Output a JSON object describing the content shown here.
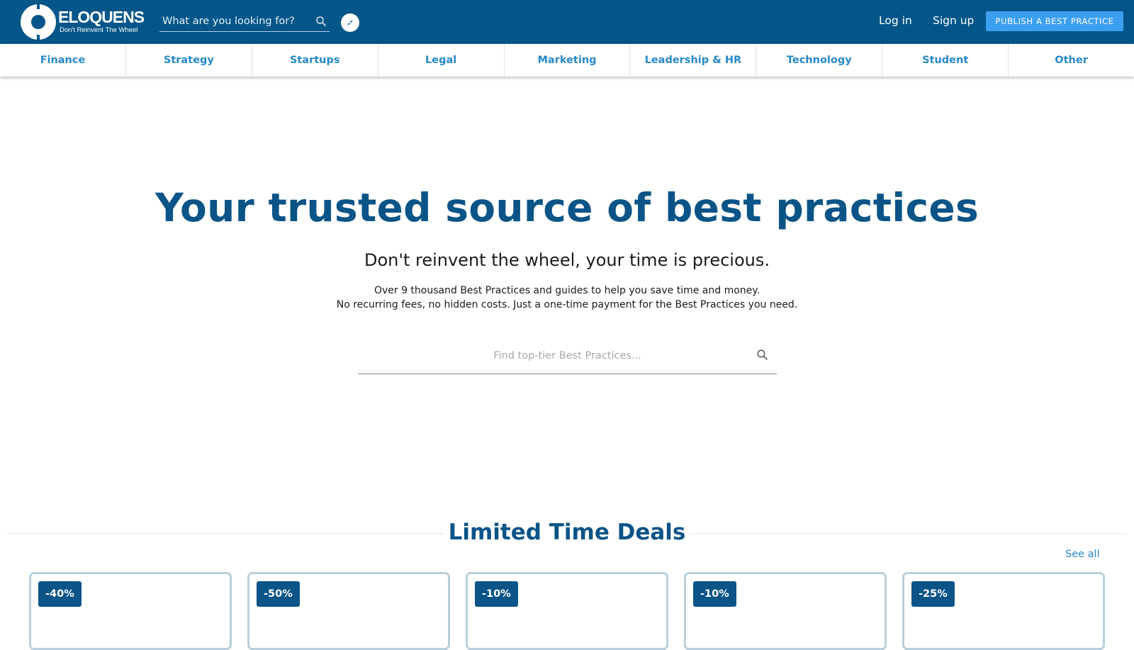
{
  "header": {
    "logo_name": "ELOQUENS",
    "logo_tagline": "Don't Reinvent The Wheel",
    "search_placeholder": "What are you looking for?",
    "login_label": "Log in",
    "signup_label": "Sign up",
    "publish_label": "PUBLISH A BEST PRACTICE"
  },
  "categories": [
    "Finance",
    "Strategy",
    "Startups",
    "Legal",
    "Marketing",
    "Leadership & HR",
    "Technology",
    "Student",
    "Other"
  ],
  "hero": {
    "title": "Your trusted source of best practices",
    "subtitle": "Don't reinvent the wheel, your time is precious.",
    "line1": "Over 9 thousand Best Practices and guides to help you save time and money.",
    "line2": "No recurring fees, no hidden costs. Just a one-time payment for the Best Practices you need.",
    "search_placeholder": "Find top-tier Best Practices..."
  },
  "deals": {
    "title": "Limited Time Deals",
    "see_all": "See all",
    "cards": [
      {
        "discount": "-40%"
      },
      {
        "discount": "-50%"
      },
      {
        "discount": "-10%"
      },
      {
        "discount": "-10%"
      },
      {
        "discount": "-25%"
      }
    ]
  },
  "colors": {
    "header_bg": "#03568a",
    "publish_bg": "#3b9ff0",
    "category_text": "#2689c9",
    "title_blue": "#0a5487"
  }
}
